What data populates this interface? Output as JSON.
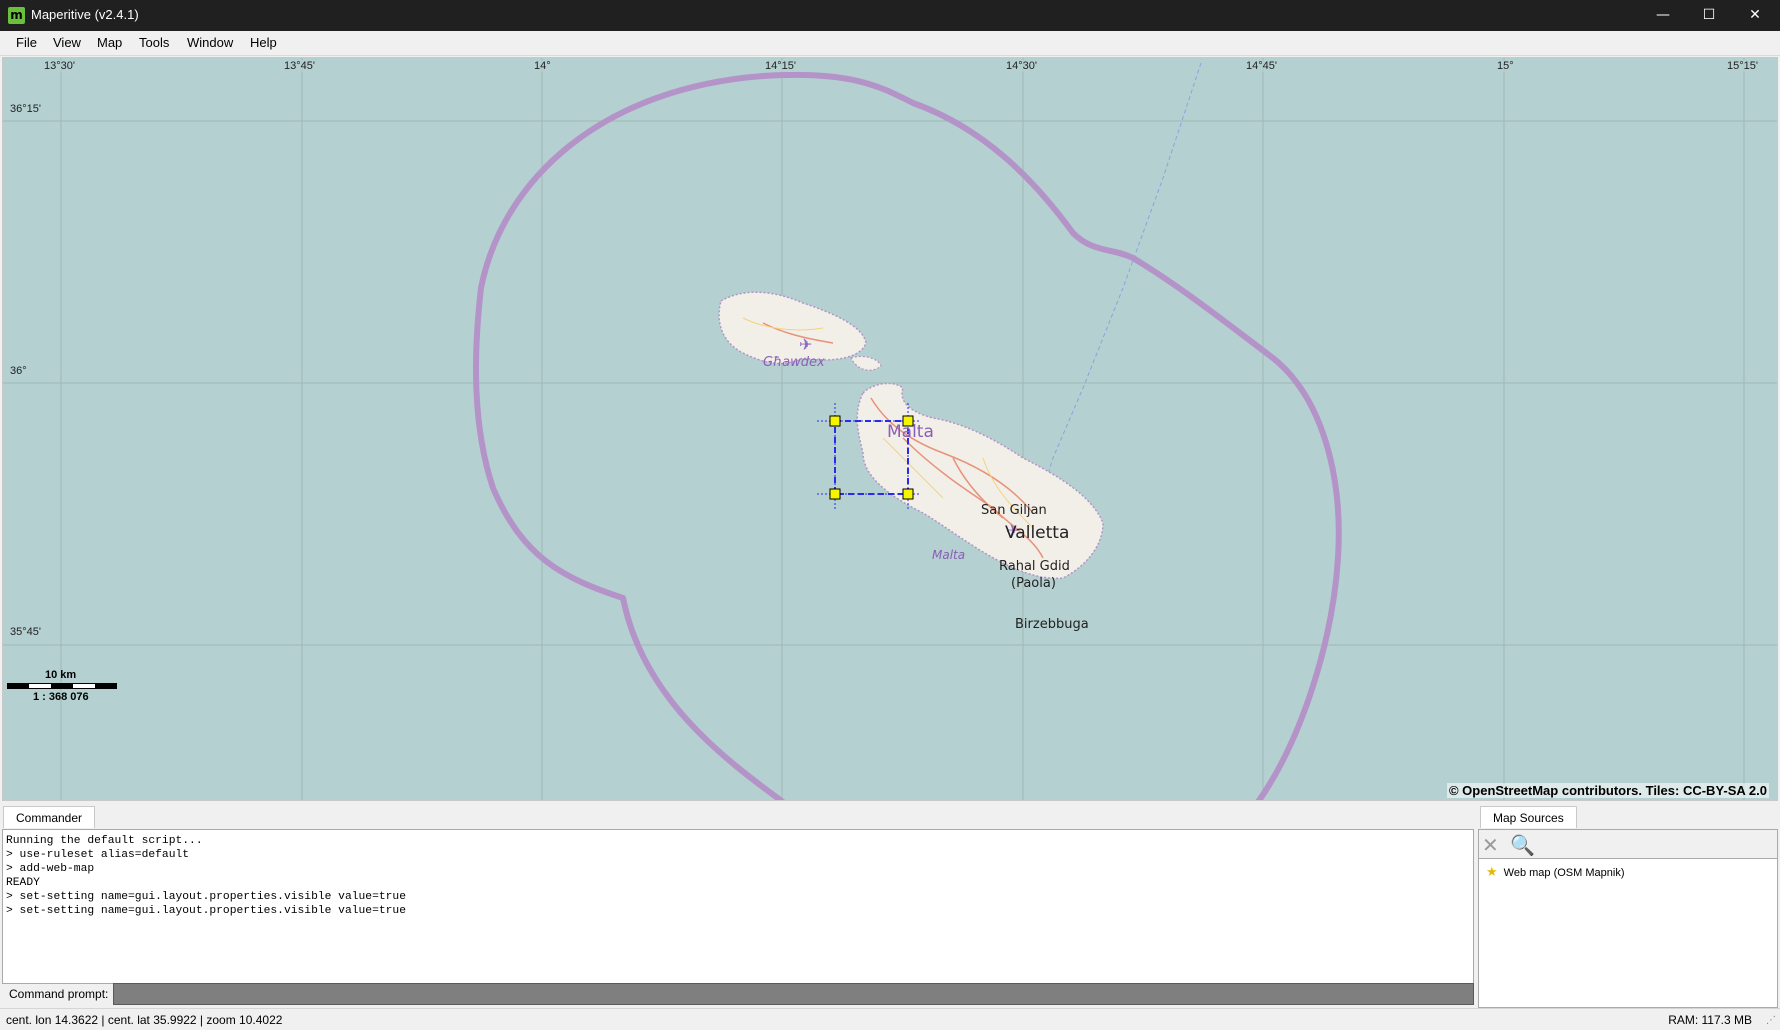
{
  "window": {
    "title": "Maperitive (v2.4.1)",
    "app_icon": "m",
    "minimize_label": "—",
    "maximize_label": "☐",
    "close_label": "✕"
  },
  "menu": [
    {
      "label": "File"
    },
    {
      "label": "View"
    },
    {
      "label": "Map"
    },
    {
      "label": "Tools"
    },
    {
      "label": "Window"
    },
    {
      "label": "Help"
    }
  ],
  "map": {
    "lon_labels": [
      "13°30'",
      "13°45'",
      "14°",
      "14°15'",
      "14°30'",
      "14°45'",
      "15°",
      "15°15'"
    ],
    "lat_labels": [
      "36°15'",
      "36°",
      "35°45'"
    ],
    "places": {
      "gozo": "Għawdex",
      "malta_island": "Malta",
      "malta_region": "Malta",
      "san_giljan": "San Giljan",
      "valletta": "Valletta",
      "rahal_gdid": "Rahal Gdid",
      "paola": "(Paola)",
      "birzebbuga": "Birzebbuga"
    },
    "scale": {
      "distance": "10 km",
      "ratio": "1 : 368 076"
    },
    "attribution": "© OpenStreetMap contributors. Tiles: CC-BY-SA 2.0",
    "colors": {
      "sea": "#b5d0d0",
      "land": "#f2efe9",
      "boundary": "#b493c8",
      "selection": "#2a2ae8",
      "handle": "#f5f500"
    }
  },
  "commander": {
    "tab_label": "Commander",
    "log_lines": [
      "Running the default script...",
      "> use-ruleset alias=default",
      "> add-web-map",
      "READY",
      "> set-setting name=gui.layout.properties.visible value=true",
      "> set-setting name=gui.layout.properties.visible value=true"
    ],
    "prompt_label": "Command prompt:",
    "prompt_value": ""
  },
  "map_sources": {
    "tab_label": "Map Sources",
    "remove_icon": "close-icon",
    "zoom_icon": "zoom-icon",
    "items": [
      {
        "label": "Web map (OSM Mapnik)",
        "icon": "star-icon"
      }
    ]
  },
  "status": {
    "left": "cent. lon 14.3622 | cent. lat 35.9922 | zoom 10.4022",
    "ram": "RAM: 117.3 MB"
  }
}
